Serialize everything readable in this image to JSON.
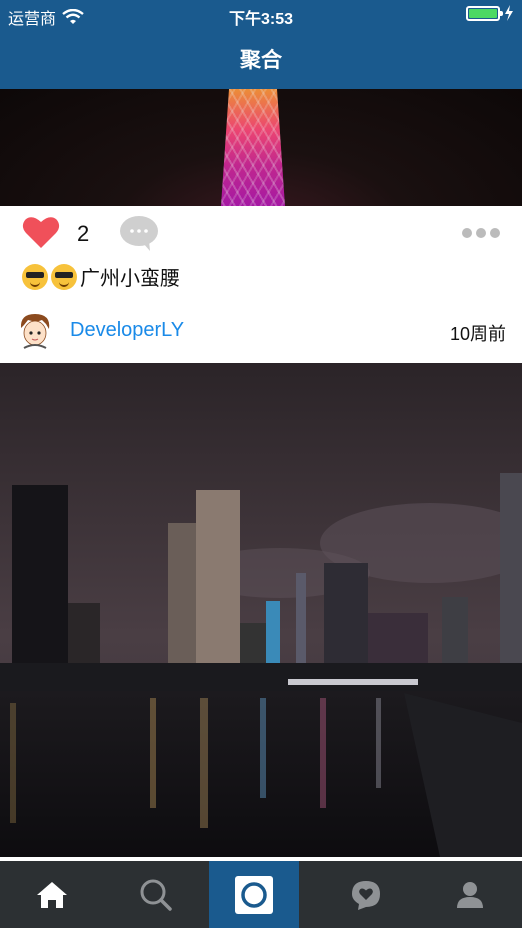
{
  "status_bar": {
    "carrier": "运营商",
    "time": "下午3:53"
  },
  "nav": {
    "title": "聚合"
  },
  "post": {
    "like_count": "2",
    "caption": "广州小蛮腰",
    "username": "DeveloperLY",
    "time_ago": "10周前"
  },
  "tabs": [
    {
      "icon": "home-icon",
      "active": false
    },
    {
      "icon": "search-icon",
      "active": false
    },
    {
      "icon": "camera-icon",
      "active": true
    },
    {
      "icon": "activity-icon",
      "active": false
    },
    {
      "icon": "profile-icon",
      "active": false
    }
  ],
  "colors": {
    "brand": "#1a5a8e",
    "tabbar": "#2c3033",
    "link": "#1a8ae8",
    "like": "#f0505a"
  }
}
